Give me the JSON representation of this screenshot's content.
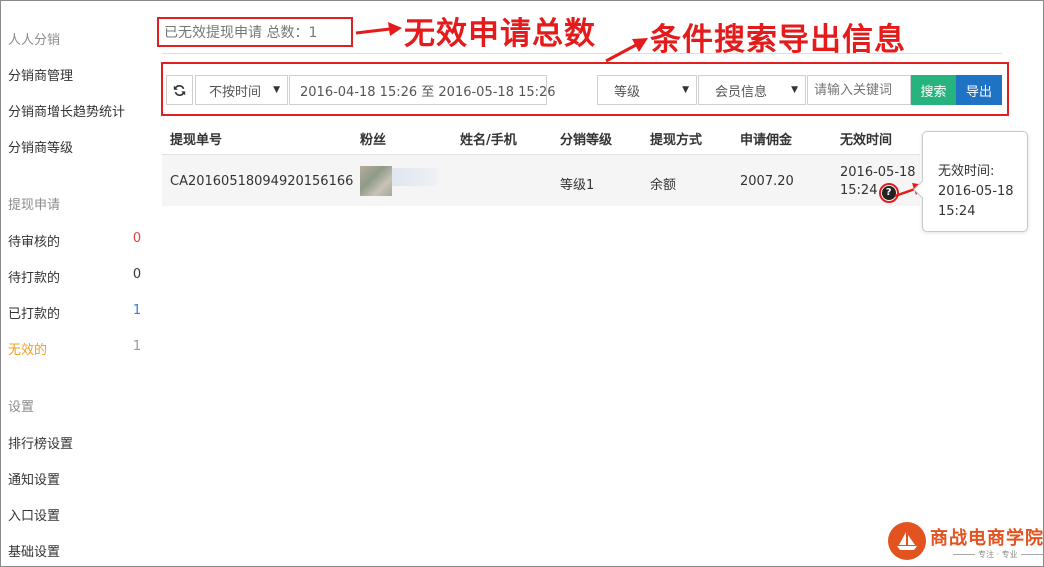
{
  "sidebar": {
    "groups": [
      {
        "title": "人人分销",
        "items": [
          {
            "label": "分销商管理",
            "count": ""
          },
          {
            "label": "分销商增长趋势统计",
            "count": ""
          },
          {
            "label": "分销商等级",
            "count": ""
          }
        ]
      },
      {
        "title": "提现申请",
        "items": [
          {
            "label": "待审核的",
            "count": "0"
          },
          {
            "label": "待打款的",
            "count": "0"
          },
          {
            "label": "已打款的",
            "count": "1"
          },
          {
            "label": "无效的",
            "count": "1"
          }
        ]
      },
      {
        "title": "设置",
        "items": [
          {
            "label": "排行榜设置",
            "count": ""
          },
          {
            "label": "通知设置",
            "count": ""
          },
          {
            "label": "入口设置",
            "count": ""
          },
          {
            "label": "基础设置",
            "count": ""
          }
        ]
      }
    ]
  },
  "header": {
    "summary": "已无效提现申请 总数：1"
  },
  "annotations": {
    "total_label": "无效申请总数",
    "export_label": "条件搜索导出信息"
  },
  "filters": {
    "time_select": "不按时间",
    "date_range": "2016-04-18 15:26 至 2016-05-18 15:26",
    "level_select": "等级",
    "member_select": "会员信息",
    "keyword_placeholder": "请输入关键词",
    "search_label": "搜索",
    "export_label": "导出"
  },
  "table": {
    "columns": [
      "提现单号",
      "粉丝",
      "姓名/手机",
      "分销等级",
      "提现方式",
      "申请佣金",
      "无效时间"
    ],
    "rows": [
      {
        "order_no": "CA20160518094920156166",
        "name_phone": "",
        "level": "等级1",
        "method": "余额",
        "amount": "2007.20",
        "invalid_date": "2016-05-18",
        "invalid_time": "15:24"
      }
    ]
  },
  "tooltip": {
    "label": "无效时间:",
    "date": "2016-05-18",
    "time": "15:24"
  },
  "logo": {
    "title": "商战电商学院",
    "subtitle": "专注 · 专业"
  },
  "colors": {
    "annotation_red": "#e51b1b",
    "active_orange": "#f0a020",
    "count_red": "#e04040",
    "count_blue": "#3a7bd5",
    "search_green": "#27b37e",
    "export_blue": "#1f73c4",
    "logo_orange": "#e2531f"
  }
}
